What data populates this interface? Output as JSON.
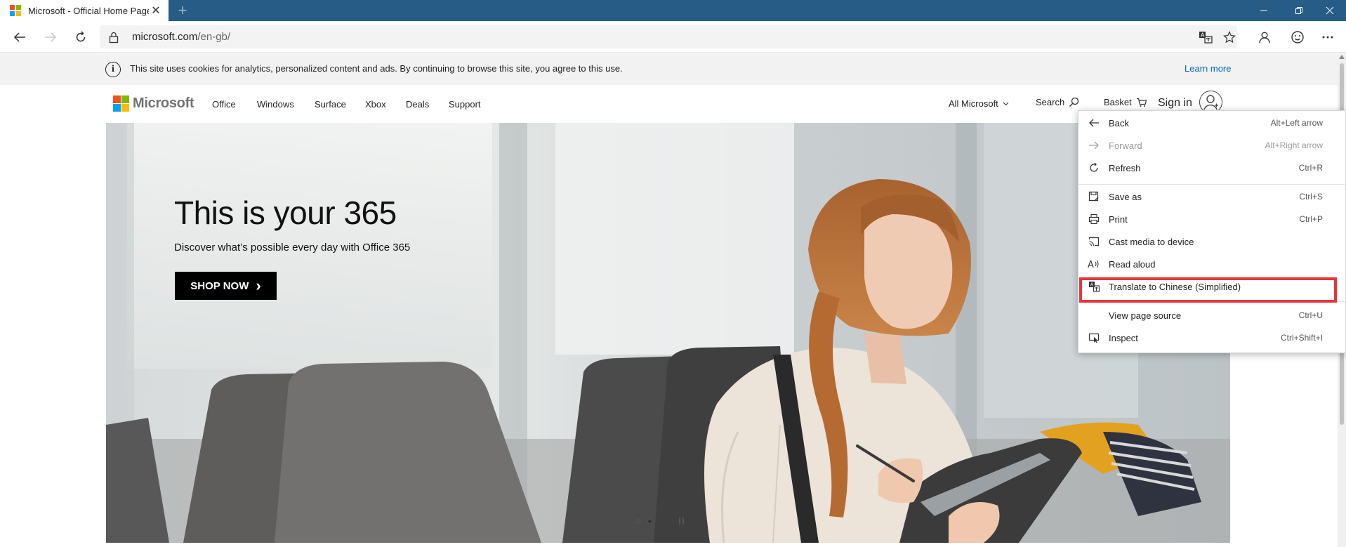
{
  "browser": {
    "tab_title": "Microsoft - Official Home Page",
    "tab_close": "✕",
    "new_tab": "+",
    "url_host": "microsoft.com",
    "url_path": "/en-gb/",
    "window_controls": {
      "minimize": "—",
      "restore": "❐",
      "close": "✕"
    }
  },
  "cookie_banner": {
    "info_glyph": "i",
    "message": "This site uses cookies for analytics, personalized content and ads. By continuing to browse this site, you agree to this use.",
    "learn_more": "Learn more"
  },
  "site_header": {
    "logo_text": "Microsoft",
    "nav": [
      "Office",
      "Windows",
      "Surface",
      "Xbox",
      "Deals",
      "Support"
    ],
    "all_microsoft": "All Microsoft",
    "search": "Search",
    "basket": "Basket",
    "sign_in": "Sign in"
  },
  "hero": {
    "title": "This is your 365",
    "subtitle": "Discover what’s possible every day with Office 365",
    "cta": "SHOP NOW",
    "cta_chevron": "›",
    "carousel_active_index": 1
  },
  "context_menu": {
    "items": [
      {
        "label": "Back",
        "shortcut": "Alt+Left arrow",
        "icon": "arrow-left-icon",
        "enabled": true
      },
      {
        "label": "Forward",
        "shortcut": "Alt+Right arrow",
        "icon": "arrow-right-icon",
        "enabled": false
      },
      {
        "label": "Refresh",
        "shortcut": "Ctrl+R",
        "icon": "refresh-icon",
        "enabled": true
      },
      {
        "label": "Save as",
        "shortcut": "Ctrl+S",
        "icon": "save-as-icon",
        "enabled": true
      },
      {
        "label": "Print",
        "shortcut": "Ctrl+P",
        "icon": "print-icon",
        "enabled": true
      },
      {
        "label": "Cast media to device",
        "shortcut": "",
        "icon": "cast-icon",
        "enabled": true
      },
      {
        "label": "Read aloud",
        "shortcut": "",
        "icon": "read-aloud-icon",
        "enabled": true
      },
      {
        "label": "Translate to Chinese (Simplified)",
        "shortcut": "",
        "icon": "translate-icon",
        "enabled": true
      },
      {
        "label": "View page source",
        "shortcut": "Ctrl+U",
        "icon": "",
        "enabled": true
      },
      {
        "label": "Inspect",
        "shortcut": "Ctrl+Shift+I",
        "icon": "inspect-icon",
        "enabled": true
      }
    ],
    "highlighted_item": "Translate to Chinese (Simplified)"
  },
  "colors": {
    "titlebar": "#265c85",
    "highlight_border": "#e8343a",
    "link": "#0067b8",
    "logo_red": "#f25022",
    "logo_green": "#7fba00",
    "logo_blue": "#00a4ef",
    "logo_yellow": "#ffb900"
  }
}
